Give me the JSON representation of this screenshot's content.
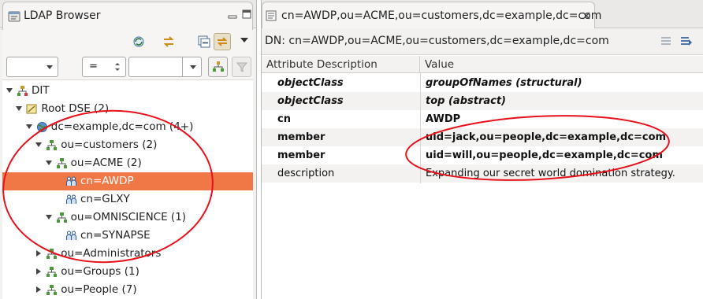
{
  "left_panel": {
    "title": "LDAP Browser",
    "filter": {
      "attribute_value": "",
      "operator_value": "=",
      "value_value": ""
    },
    "tree": [
      {
        "label": "DIT",
        "depth": 0,
        "expanded": true,
        "icon": "dit-icon"
      },
      {
        "label": "Root DSE (2)",
        "depth": 1,
        "expanded": true,
        "icon": "root-dse-icon"
      },
      {
        "label": "dc=example,dc=com (4+)",
        "depth": 2,
        "expanded": true,
        "icon": "globe-icon"
      },
      {
        "label": "ou=customers (2)",
        "depth": 3,
        "expanded": true,
        "icon": "org-unit-icon"
      },
      {
        "label": "ou=ACME (2)",
        "depth": 4,
        "expanded": true,
        "icon": "org-unit-icon"
      },
      {
        "label": "cn=AWDP",
        "depth": 5,
        "leaf": true,
        "selected": true,
        "icon": "group-icon"
      },
      {
        "label": "cn=GLXY",
        "depth": 5,
        "leaf": true,
        "icon": "group-icon"
      },
      {
        "label": "ou=OMNISCIENCE (1)",
        "depth": 4,
        "expanded": true,
        "icon": "org-unit-icon"
      },
      {
        "label": "cn=SYNAPSE",
        "depth": 5,
        "leaf": true,
        "icon": "group-icon"
      },
      {
        "label": "ou=Administrators",
        "depth": 3,
        "expanded": false,
        "icon": "org-unit-icon"
      },
      {
        "label": "ou=Groups (1)",
        "depth": 3,
        "expanded": false,
        "icon": "org-unit-icon"
      },
      {
        "label": "ou=People (7)",
        "depth": 3,
        "expanded": false,
        "icon": "org-unit-icon"
      }
    ]
  },
  "editor": {
    "tab_title": "cn=AWDP,ou=ACME,ou=customers,dc=example,dc=com",
    "dn_label": "DN: cn=AWDP,ou=ACME,ou=customers,dc=example,dc=com",
    "columns": [
      "Attribute Description",
      "Value"
    ],
    "rows": [
      {
        "attribute": "objectClass",
        "value": "groupOfNames (structural)",
        "style": "bold-italic"
      },
      {
        "attribute": "objectClass",
        "value": "top (abstract)",
        "style": "bold-italic"
      },
      {
        "attribute": "cn",
        "value": "AWDP",
        "style": "bold"
      },
      {
        "attribute": "member",
        "value": "uid=jack,ou=people,dc=example,dc=com",
        "style": "bold"
      },
      {
        "attribute": "member",
        "value": "uid=will,ou=people,dc=example,dc=com",
        "style": "bold"
      },
      {
        "attribute": "description",
        "value": "Expanding our secret world domination strategy.",
        "style": "normal"
      }
    ]
  },
  "colors": {
    "selection": "#f07746",
    "annotation": "#e8101a",
    "org_unit_icon": "#4a9a3a"
  }
}
